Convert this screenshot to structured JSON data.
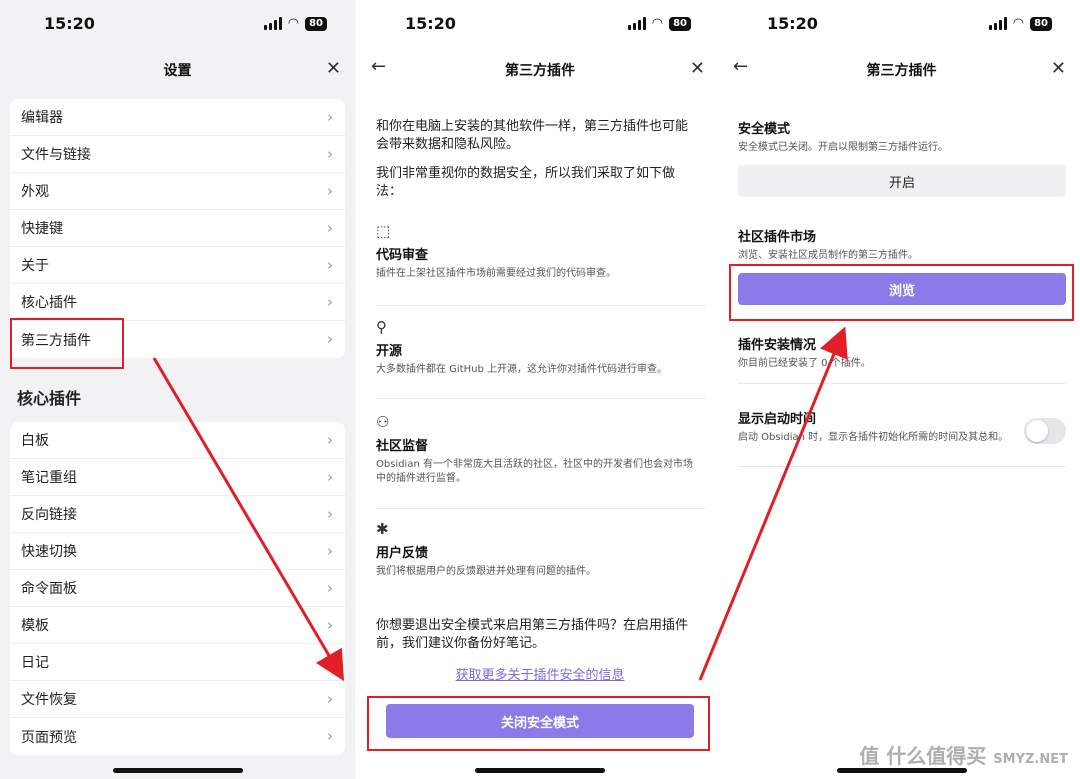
{
  "status": {
    "time": "15:20",
    "battery": "80"
  },
  "screen1": {
    "title": "设置",
    "settings_items": [
      "编辑器",
      "文件与链接",
      "外观",
      "快捷键",
      "关于",
      "核心插件",
      "第三方插件"
    ],
    "section_title": "核心插件",
    "core_items": [
      "白板",
      "笔记重组",
      "反向链接",
      "快速切换",
      "命令面板",
      "模板",
      "日记",
      "文件恢复",
      "页面预览"
    ]
  },
  "screen2": {
    "title": "第三方插件",
    "intro": "和你在电脑上安装的其他软件一样，第三方插件也可能会带来数据和隐私风险。",
    "intro2": "我们非常重视你的数据安全，所以我们采取了如下做法：",
    "features": [
      {
        "icon": "review-icon",
        "name": "代码审查",
        "desc": "插件在上架社区插件市场前需要经过我们的代码审查。"
      },
      {
        "icon": "github-icon",
        "name": "开源",
        "desc": "大多数插件都在 GitHub 上开源，这允许你对插件代码进行审查。"
      },
      {
        "icon": "users-icon",
        "name": "社区监督",
        "desc": "Obsidian 有一个非常庞大且活跃的社区，社区中的开发者们也会对市场中的插件进行监督。"
      },
      {
        "icon": "bug-icon",
        "name": "用户反馈",
        "desc": "我们将根据用户的反馈跟进并处理有问题的插件。"
      }
    ],
    "question": "你想要退出安全模式来启用第三方插件吗？在启用插件前，我们建议你备份好笔记。",
    "link": "获取更多关于插件安全的信息",
    "button": "关闭安全模式"
  },
  "screen3": {
    "title": "第三方插件",
    "safe_mode_title": "安全模式",
    "safe_mode_desc": "安全模式已关闭。开启以限制第三方插件运行。",
    "safe_mode_button": "开启",
    "market_title": "社区插件市场",
    "market_desc": "浏览、安装社区成员制作的第三方插件。",
    "browse_button": "浏览",
    "installed_title": "插件安装情况",
    "installed_desc": "你目前已经安装了 0 个插件。",
    "startup_title": "显示启动时间",
    "startup_desc": "启动 Obsidian 时，显示各插件初始化所需的时间及其总和。",
    "startup_toggle": false
  },
  "watermark": "值 什么值得买",
  "watermark2": "SMYZ.NET",
  "colors": {
    "accent": "#8b7be8",
    "highlight": "#e01f26"
  }
}
